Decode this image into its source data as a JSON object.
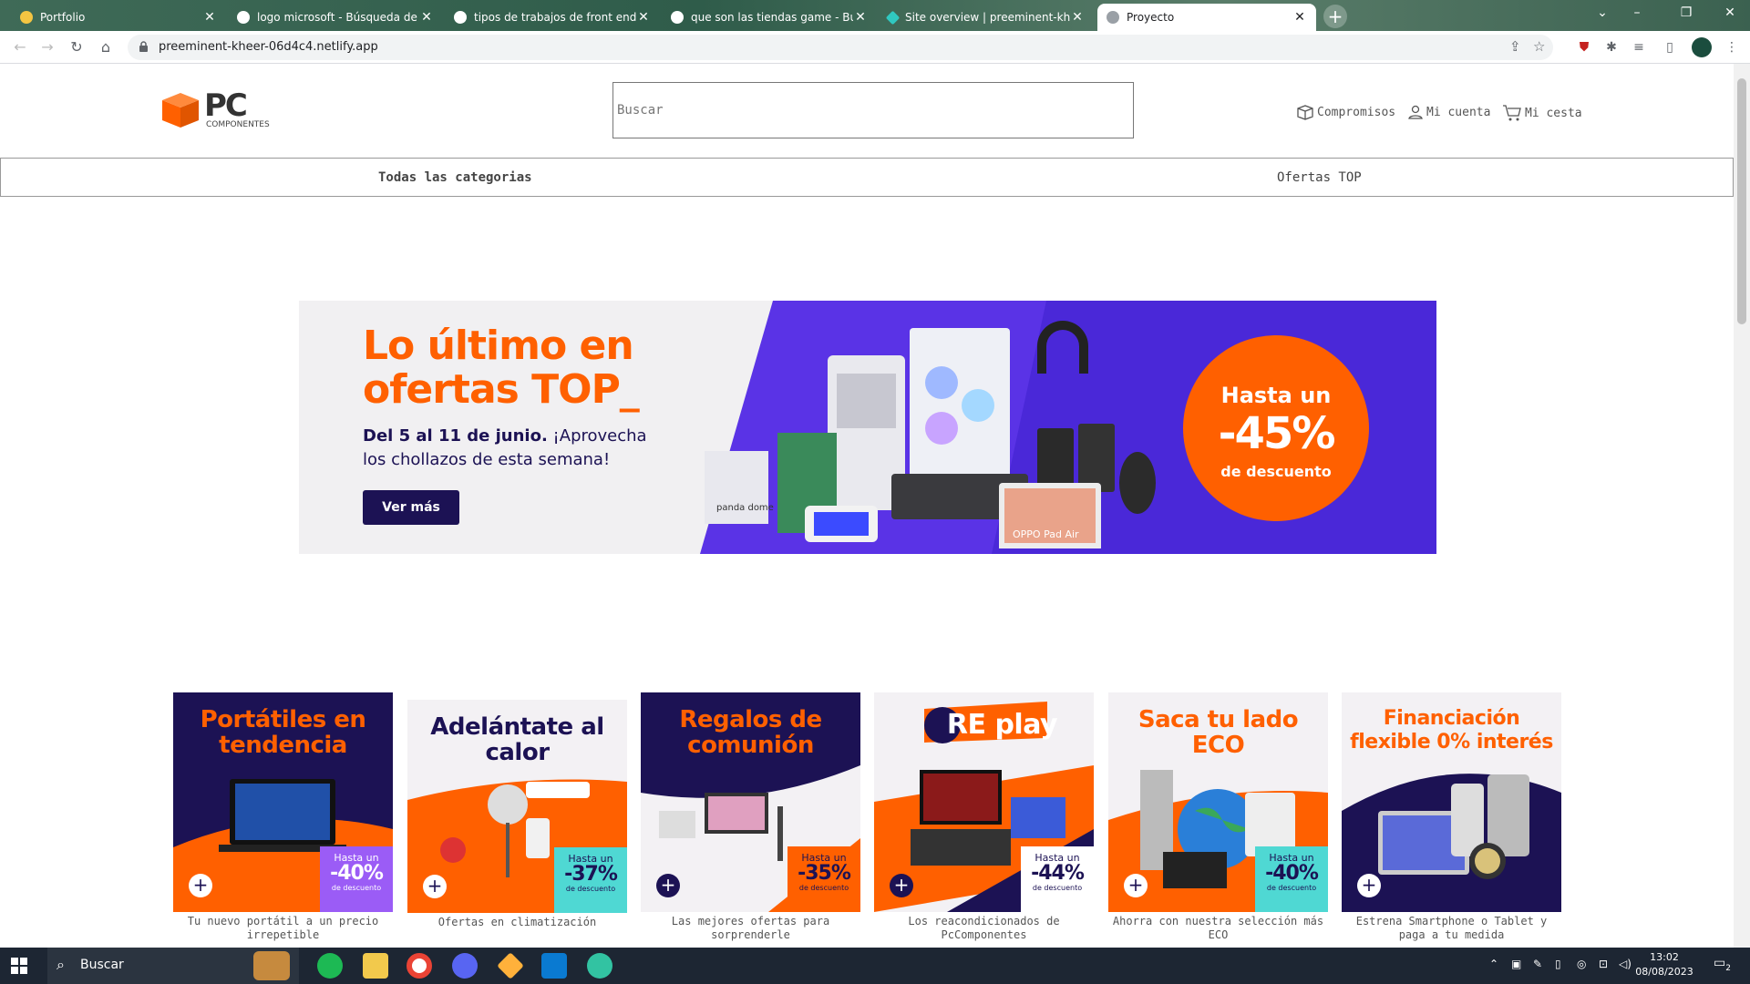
{
  "browser": {
    "tabs": [
      {
        "title": "Portfolio"
      },
      {
        "title": "logo microsoft - Búsqueda de G"
      },
      {
        "title": "tipos de trabajos de front end y"
      },
      {
        "title": "que son las tiendas game - Busc"
      },
      {
        "title": "Site overview | preeminent-khee"
      },
      {
        "title": "Proyecto"
      }
    ],
    "url": "preeminent-kheer-06d4c4.netlify.app",
    "new_tab": "+"
  },
  "header": {
    "logo_main": "PC",
    "logo_sub": "COMPONENTES",
    "search_placeholder": "Buscar",
    "links": {
      "compromisos": "Compromisos",
      "mi_cuenta": "Mi cuenta",
      "mi_cesta": "Mi cesta"
    }
  },
  "nav": {
    "categorias": "Todas las categorias",
    "ofertas": "Ofertas TOP"
  },
  "hero": {
    "title_line1": "Lo último en",
    "title_line2": "ofertas TOP_",
    "subtitle_bold": "Del 5 al 11 de junio.",
    "subtitle_rest": " ¡Aprovecha los chollazos de esta semana!",
    "cta": "Ver más",
    "badge_top": "Hasta un",
    "badge_pct": "-45%",
    "badge_bottom": "de descuento",
    "product_label": "OPPO Pad Air",
    "box_label": "panda dome"
  },
  "cards": [
    {
      "title": "Portátiles en tendencia",
      "badge_top": "Hasta un",
      "badge_pct": "-40%",
      "badge_bottom": "de descuento",
      "caption": "Tu nuevo portátil a un precio irrepetible",
      "colors": {
        "bg": "#1c1254",
        "title": "#ff6000",
        "badge": "#9b5cf6"
      }
    },
    {
      "title": "Adelántate al calor",
      "badge_top": "Hasta un",
      "badge_pct": "-37%",
      "badge_bottom": "de descuento",
      "caption": "Ofertas en climatización",
      "colors": {
        "bg": "#f3f1f4",
        "title": "#1c1254",
        "badge": "#4fd8d3"
      }
    },
    {
      "title": "Regalos de comunión",
      "badge_top": "Hasta un",
      "badge_pct": "-35%",
      "badge_bottom": "de descuento",
      "caption": "Las mejores ofertas para sorprenderle",
      "colors": {
        "bg": "#1c1254",
        "title": "#ff6000",
        "badge": "#ff6000"
      }
    },
    {
      "title": "RE play",
      "badge_top": "Hasta un",
      "badge_pct": "-44%",
      "badge_bottom": "de descuento",
      "caption": "Los reacondicionados de PcComponentes",
      "colors": {
        "bg": "#f3f1f4",
        "title": "#ff6000",
        "badge": "#ffffff"
      }
    },
    {
      "title": "Saca tu lado ECO",
      "badge_top": "Hasta un",
      "badge_pct": "-40%",
      "badge_bottom": "de descuento",
      "caption": "Ahorra con nuestra selección más ECO",
      "colors": {
        "bg": "#f3f1f4",
        "title": "#ff6000",
        "badge": "#4fd8d3"
      }
    },
    {
      "title": "Financiación flexible 0% interés",
      "badge_top": "",
      "badge_pct": "",
      "badge_bottom": "",
      "caption": "Estrena Smartphone o Tablet y paga a tu medida",
      "colors": {
        "bg": "#f3f1f4",
        "title": "#ff6000",
        "badge": "#1c1254"
      }
    }
  ],
  "taskbar": {
    "search": "Buscar",
    "time": "13:02",
    "date": "08/08/2023",
    "notifications": "2"
  },
  "colors": {
    "brand_orange": "#ff6000",
    "brand_navy": "#1c1254",
    "hero_purple": "#5a33e6"
  }
}
